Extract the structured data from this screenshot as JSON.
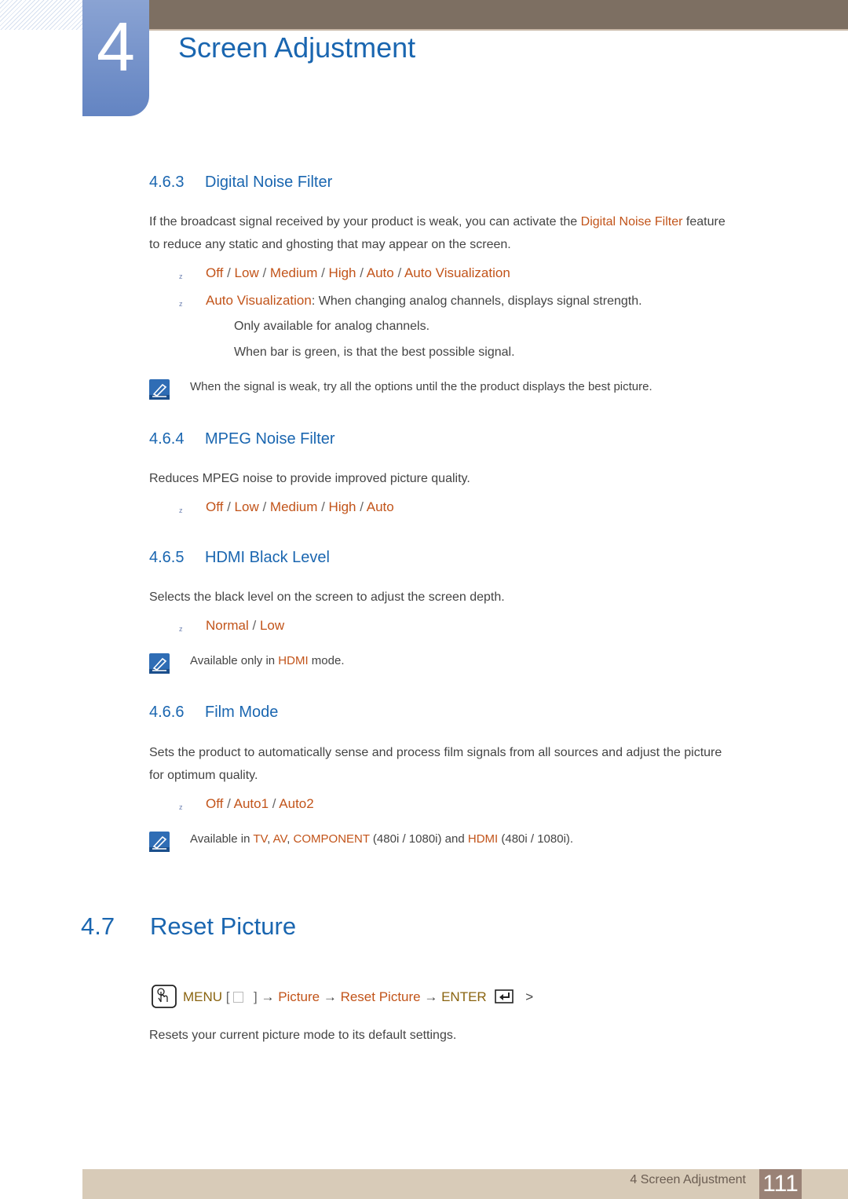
{
  "header": {
    "chapter_number": "4",
    "chapter_title": "Screen Adjustment"
  },
  "colors": {
    "heading_blue": "#1a66b0",
    "highlight_orange": "#c2541a",
    "menu_gold": "#8a6410",
    "top_bar": "#7d6f62",
    "footer_bg": "#d8cbb8",
    "page_box": "#9a8276"
  },
  "sections": {
    "dnf": {
      "number": "4.6.3",
      "title": "Digital Noise Filter",
      "desc_pre": "If the broadcast signal received by your product is weak, you can activate the ",
      "desc_hl": "Digital Noise Filter",
      "desc_post": " feature",
      "desc_line2": "to reduce any static and ghosting that may appear on the screen.",
      "options": [
        "Off",
        "Low",
        "Medium",
        "High",
        "Auto",
        "Auto Visualization"
      ],
      "av_label": "Auto Visualization",
      "av_desc": ": When changing analog channels, displays signal strength.",
      "av_line2": "Only available for analog channels.",
      "av_line3": "When bar is green, is that the best possible signal.",
      "note": "When the signal is weak, try all the options until the the product displays the best picture."
    },
    "mpeg": {
      "number": "4.6.4",
      "title": "MPEG Noise Filter",
      "desc": "Reduces MPEG noise to provide improved picture quality.",
      "options": [
        "Off",
        "Low",
        "Medium",
        "High",
        "Auto"
      ]
    },
    "hdmi": {
      "number": "4.6.5",
      "title": "HDMI Black Level",
      "desc": "Selects the black level on the screen to adjust the screen depth.",
      "options": [
        "Normal",
        "Low"
      ],
      "note_pre": "Available only in ",
      "note_hl": "HDMI",
      "note_post": " mode."
    },
    "film": {
      "number": "4.6.6",
      "title": "Film Mode",
      "desc_line1": "Sets the product to automatically sense and process film signals from all sources and adjust the picture",
      "desc_line2": "for optimum quality.",
      "options": [
        "Off",
        "Auto1",
        "Auto2"
      ],
      "note": {
        "t1": "Available in ",
        "tv": "TV",
        "c1": ", ",
        "av": "AV",
        "c2": ", ",
        "comp": "COMPONENT",
        "t2": " (480i / 1080i) and ",
        "hdmi": "HDMI",
        "t3": " (480i / 1080i)."
      }
    },
    "reset": {
      "number": "4.7",
      "title": "Reset Picture",
      "menu": "MENU",
      "bracket_open": "[",
      "bracket_close": "]",
      "arrow": "→",
      "path1": "Picture",
      "path2": "Reset Picture",
      "enter": "ENTER",
      "tail": ">",
      "desc": "Resets your current picture mode to its default settings."
    }
  },
  "footer": {
    "label": "4 Screen Adjustment",
    "page": "111"
  }
}
